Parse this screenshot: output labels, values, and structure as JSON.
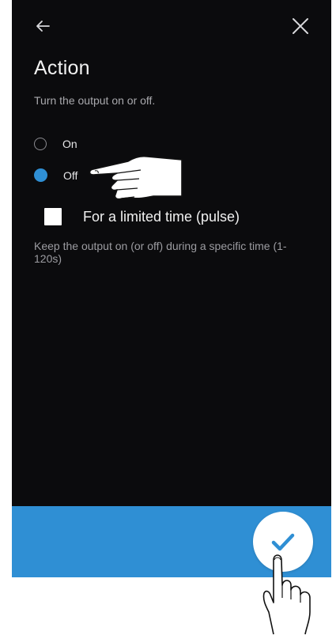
{
  "header": {
    "back_icon": "arrow-left-icon",
    "close_icon": "close-icon"
  },
  "page": {
    "title": "Action",
    "subtitle": "Turn the output on or off."
  },
  "options": {
    "on_label": "On",
    "off_label": "Off",
    "selected": "Off"
  },
  "pulse": {
    "label": "For a limited time (pulse)",
    "checked": false,
    "help": "Keep the output on (or off) during a specific time (1-120s)"
  },
  "footer": {
    "confirm_icon": "checkmark-icon"
  },
  "colors": {
    "accent": "#2f8fd4",
    "background": "#0b0b0d"
  }
}
